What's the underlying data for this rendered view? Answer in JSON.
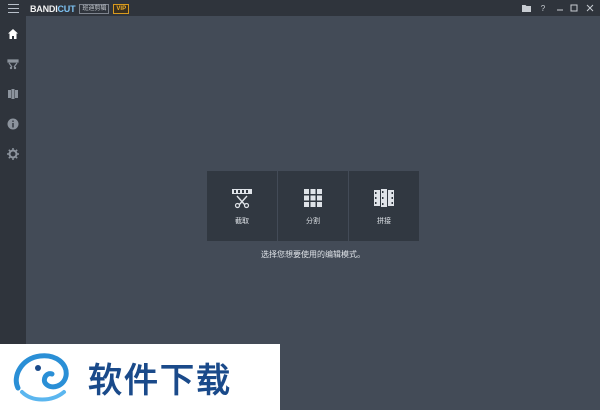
{
  "titlebar": {
    "brand_main": "BANDI",
    "brand_accent": "CUT",
    "brand_sub": "班迪剪辑",
    "vip_badge": "VIP",
    "help_label": "?"
  },
  "sidebar": {
    "items": [
      {
        "name": "home",
        "icon": "home-icon"
      },
      {
        "name": "cut",
        "icon": "cut-tool-icon"
      },
      {
        "name": "clips",
        "icon": "clips-icon"
      },
      {
        "name": "info",
        "icon": "info-icon"
      },
      {
        "name": "settings",
        "icon": "gear-icon"
      }
    ]
  },
  "main": {
    "modes": [
      {
        "label": "截取",
        "icon": "trim-film-icon"
      },
      {
        "label": "分割",
        "icon": "split-grid-icon"
      },
      {
        "label": "拼接",
        "icon": "join-film-icon"
      }
    ],
    "hint": "选择您想要使用的编辑模式。"
  },
  "watermark": {
    "text": "软件下载"
  },
  "colors": {
    "titlebar_bg": "#2f343c",
    "main_bg": "#434b57",
    "button_bg": "#313841",
    "brand_accent": "#7ec3f4",
    "vip": "#f0b02a"
  }
}
